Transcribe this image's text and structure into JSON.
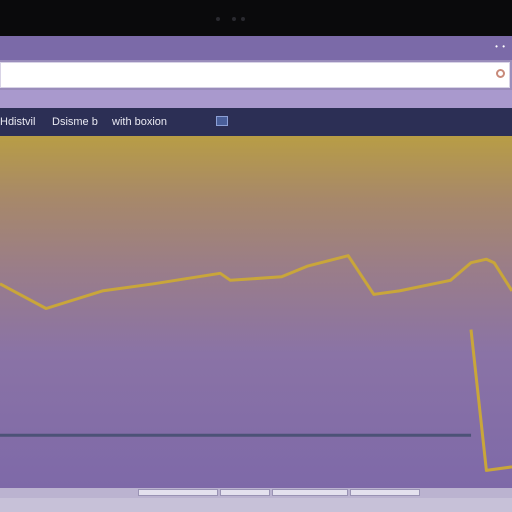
{
  "toolbar": {
    "item_1": "Hdistvil",
    "item_2": "Dsisme b",
    "item_3": "with boxion"
  },
  "colors": {
    "title_bar": "#7b6aa8",
    "toolbar": "#2c2f55",
    "series_line": "#c9a63a",
    "baseline": "#4c5277"
  },
  "chart_data": {
    "type": "line",
    "title": "",
    "xlabel": "",
    "ylabel": "",
    "grid": false,
    "ylim": [
      0,
      100
    ],
    "xlim": [
      0,
      100
    ],
    "series": [
      {
        "x": [
          0,
          9,
          20,
          30,
          43,
          45,
          55,
          60,
          68,
          73,
          78,
          88,
          92,
          95,
          96.5,
          100
        ],
        "y": [
          58,
          51,
          56,
          58,
          61,
          59,
          60,
          63,
          66,
          55,
          56,
          59,
          64,
          65,
          64,
          56
        ]
      },
      {
        "x": [
          92,
          95,
          100
        ],
        "y": [
          45,
          5,
          6
        ]
      }
    ],
    "reference_line": {
      "y": 15
    }
  }
}
